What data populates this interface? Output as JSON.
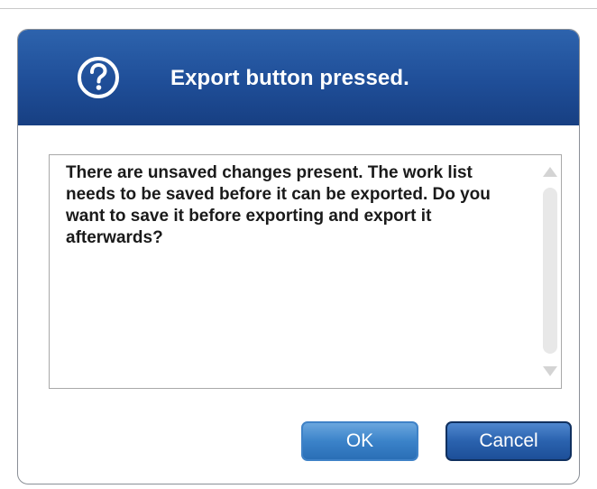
{
  "dialog": {
    "title": "Export button pressed.",
    "icon": "question-icon",
    "message": "There are unsaved changes present. The work list needs to be saved before it can be exported. Do you want to save it before exporting and export it afterwards?",
    "ok_label": "OK",
    "cancel_label": "Cancel"
  },
  "colors": {
    "titlebar": "#1f4e98",
    "ok_button": "#3b83c9",
    "cancel_button": "#2a62ae"
  }
}
